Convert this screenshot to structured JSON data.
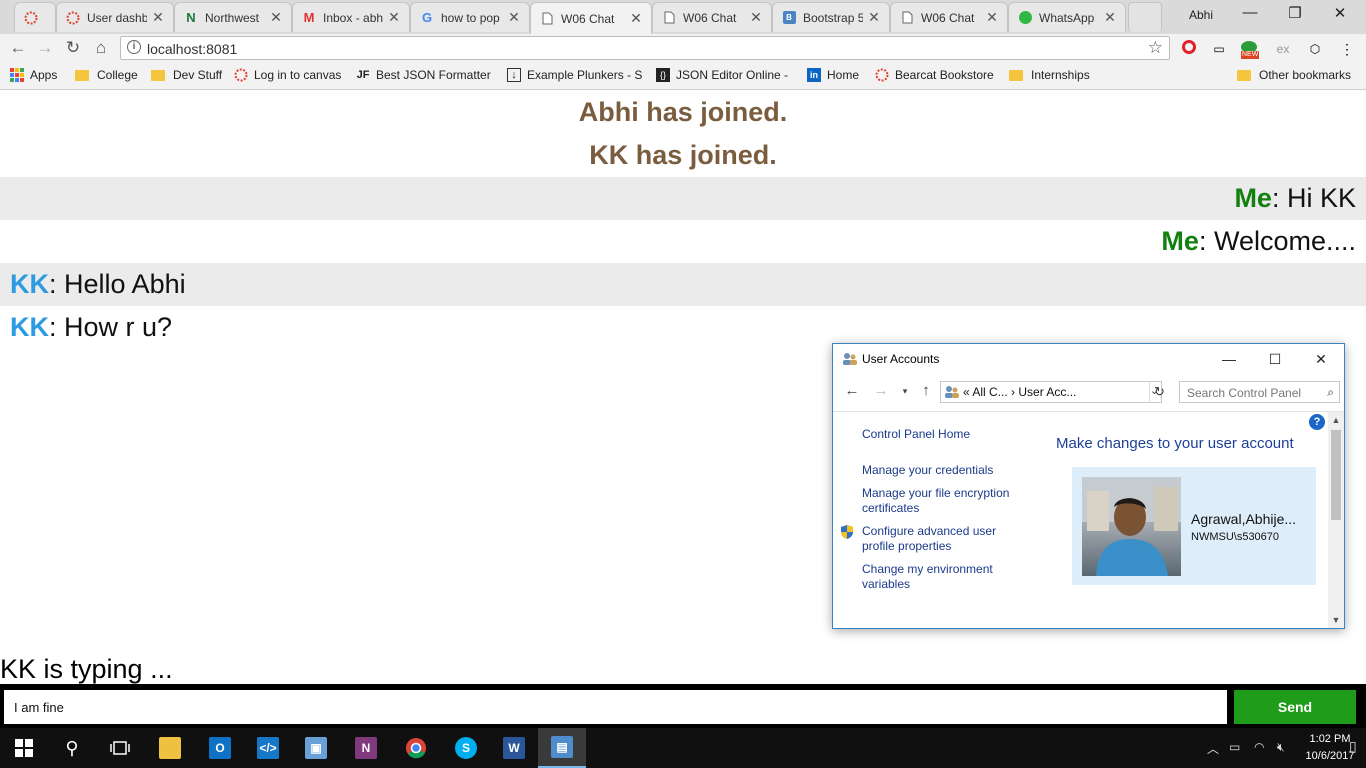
{
  "browser": {
    "tabs": [
      {
        "label": "",
        "icon": "canvas-icon"
      },
      {
        "label": "User dashb",
        "icon": "canvas-icon"
      },
      {
        "label": "Northwest",
        "icon": "northwest-icon"
      },
      {
        "label": "Inbox - abh",
        "icon": "gmail-icon"
      },
      {
        "label": "how to pop",
        "icon": "google-icon"
      },
      {
        "label": "W06 Chat",
        "icon": "page-icon"
      },
      {
        "label": "W06 Chat",
        "icon": "page-icon"
      },
      {
        "label": "Bootstrap 5",
        "icon": "bootstrap-icon"
      },
      {
        "label": "W06 Chat",
        "icon": "page-icon"
      },
      {
        "label": "WhatsApp",
        "icon": "whatsapp-icon"
      }
    ],
    "profile_name": "Abhi",
    "url": "localhost:8081",
    "bookmarks": [
      "Apps",
      "College",
      "Dev Stuff",
      "Log in to canvas",
      "Best JSON Formatter",
      "Example Plunkers - S",
      "JSON Editor Online -",
      "Home",
      "Bearcat Bookstore",
      "Internships"
    ],
    "other_bookmarks": "Other bookmarks",
    "ext_new_badge": "NEW"
  },
  "chat": {
    "system_messages": [
      "Abhi has joined.",
      "KK has joined."
    ],
    "messages": [
      {
        "sender": "Me",
        "sep": ": ",
        "text": "Hi KK"
      },
      {
        "sender": "Me",
        "sep": ": ",
        "text": "Welcome...."
      },
      {
        "sender": "KK",
        "sep": ": ",
        "text": "Hello Abhi"
      },
      {
        "sender": "KK",
        "sep": ": ",
        "text": "How r u?"
      }
    ],
    "typing_indicator": "KK is typing ...",
    "input_value": "I am fine",
    "send_label": "Send",
    "colors": {
      "me": "#138010",
      "kk": "#2d9be0",
      "system": "#7a5c3e",
      "send": "#1f9d1a"
    }
  },
  "user_accounts": {
    "title": "User Accounts",
    "breadcrumb": "«  All C...  ›  User Acc...",
    "search_placeholder": "Search Control Panel",
    "links": [
      "Control Panel Home",
      "Manage your credentials",
      "Manage your file encryption certificates",
      "Configure advanced user profile properties",
      "Change my environment variables"
    ],
    "heading": "Make changes to your user account",
    "account_name": "Agrawal,Abhije...",
    "account_domain": "NWMSU\\s530670"
  },
  "taskbar": {
    "time": "1:02 PM",
    "date": "10/6/2017"
  }
}
